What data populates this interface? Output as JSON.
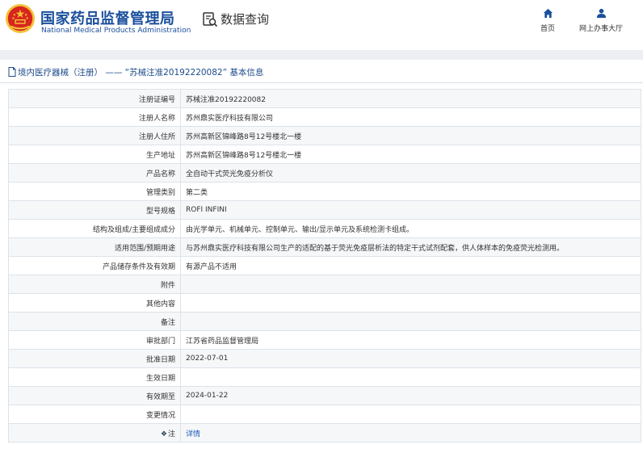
{
  "header": {
    "brand_cn": "国家药品监督管理局",
    "brand_en": "National Medical Products Administration",
    "query_label": "数据查询",
    "nav": [
      {
        "label": "首页",
        "icon": "home-icon"
      },
      {
        "label": "网上办事大厅",
        "icon": "user-icon"
      }
    ]
  },
  "breadcrumb": "境内医疗器械（注册） —— “苏械注准20192220082” 基本信息",
  "rows": [
    {
      "key": "注册证编号",
      "value": "苏械注准20192220082"
    },
    {
      "key": "注册人名称",
      "value": "苏州鼎实医疗科技有限公司"
    },
    {
      "key": "注册人住所",
      "value": "苏州高新区锦峰路8号12号楼北一楼"
    },
    {
      "key": "生产地址",
      "value": "苏州高新区锦峰路8号12号楼北一楼"
    },
    {
      "key": "产品名称",
      "value": "全自动干式荧光免疫分析仪"
    },
    {
      "key": "管理类别",
      "value": "第二类"
    },
    {
      "key": "型号规格",
      "value": "ROFI INFINI"
    },
    {
      "key": "结构及组成/主要组成成分",
      "value": "由光学单元、机械单元、控制单元、输出/显示单元及系统检测卡组成。"
    },
    {
      "key": "适用范围/预期用途",
      "value": "与苏州鼎实医疗科技有限公司生产的适配的基于荧光免疫层析法的特定干式试剂配套，供人体样本的免疫荧光检测用。"
    },
    {
      "key": "产品储存条件及有效期",
      "value": "有源产品不适用"
    },
    {
      "key": "附件",
      "value": ""
    },
    {
      "key": "其他内容",
      "value": ""
    },
    {
      "key": "备注",
      "value": ""
    },
    {
      "key": "审批部门",
      "value": "江苏省药品监督管理局"
    },
    {
      "key": "批准日期",
      "value": "2022-07-01"
    },
    {
      "key": "生效日期",
      "value": ""
    },
    {
      "key": "有效期至",
      "value": "2024-01-22"
    },
    {
      "key": "变更情况",
      "value": ""
    },
    {
      "key": "注",
      "value": "详情"
    }
  ],
  "colors": {
    "brand": "#1a4f9c",
    "link": "#1a5bb8",
    "emblem_red": "#d7261e",
    "emblem_gold": "#f3c13a"
  }
}
